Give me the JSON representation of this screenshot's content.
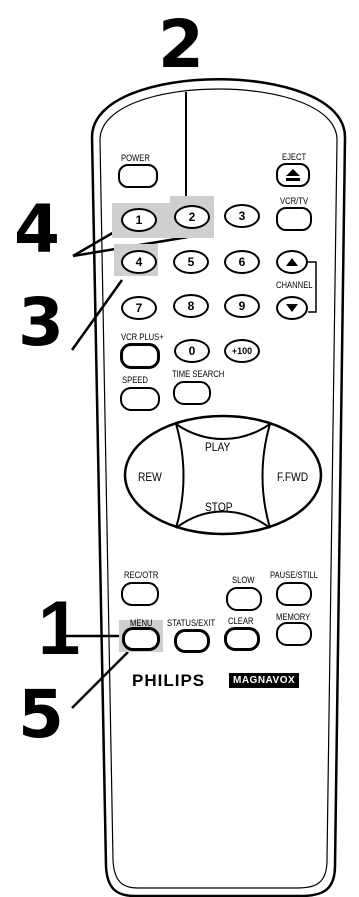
{
  "steps": {
    "two": "2",
    "four": "4",
    "three": "3",
    "one": "1",
    "five": "5"
  },
  "remote": {
    "power": "POWER",
    "eject": "EJECT",
    "vcr_tv": "VCR/TV",
    "channel": "CHANNEL",
    "vcr_plus": "VCR PLUS+",
    "speed": "SPEED",
    "time_search": "TIME SEARCH",
    "rec_otr": "REC/OTR",
    "slow": "SLOW",
    "pause_still": "PAUSE/STILL",
    "menu": "MENU",
    "status_exit": "STATUS/EXIT",
    "clear": "CLEAR",
    "memory": "MEMORY",
    "brand_philips": "PHILIPS",
    "brand_magnavox": "MAGNAVOX"
  },
  "keypad": {
    "k1": "1",
    "k2": "2",
    "k3": "3",
    "k4": "4",
    "k5": "5",
    "k6": "6",
    "k7": "7",
    "k8": "8",
    "k9": "9",
    "k0": "0",
    "k100": "+100"
  },
  "transport": {
    "play": "PLAY",
    "rew": "REW",
    "ffwd": "F.FWD",
    "stop": "STOP"
  },
  "icons": {
    "eject": "eject-icon",
    "channel_up": "triangle-up-icon",
    "channel_down": "triangle-down-icon"
  },
  "colors": {
    "highlight": "#cfcfcf",
    "ink": "#000000"
  }
}
